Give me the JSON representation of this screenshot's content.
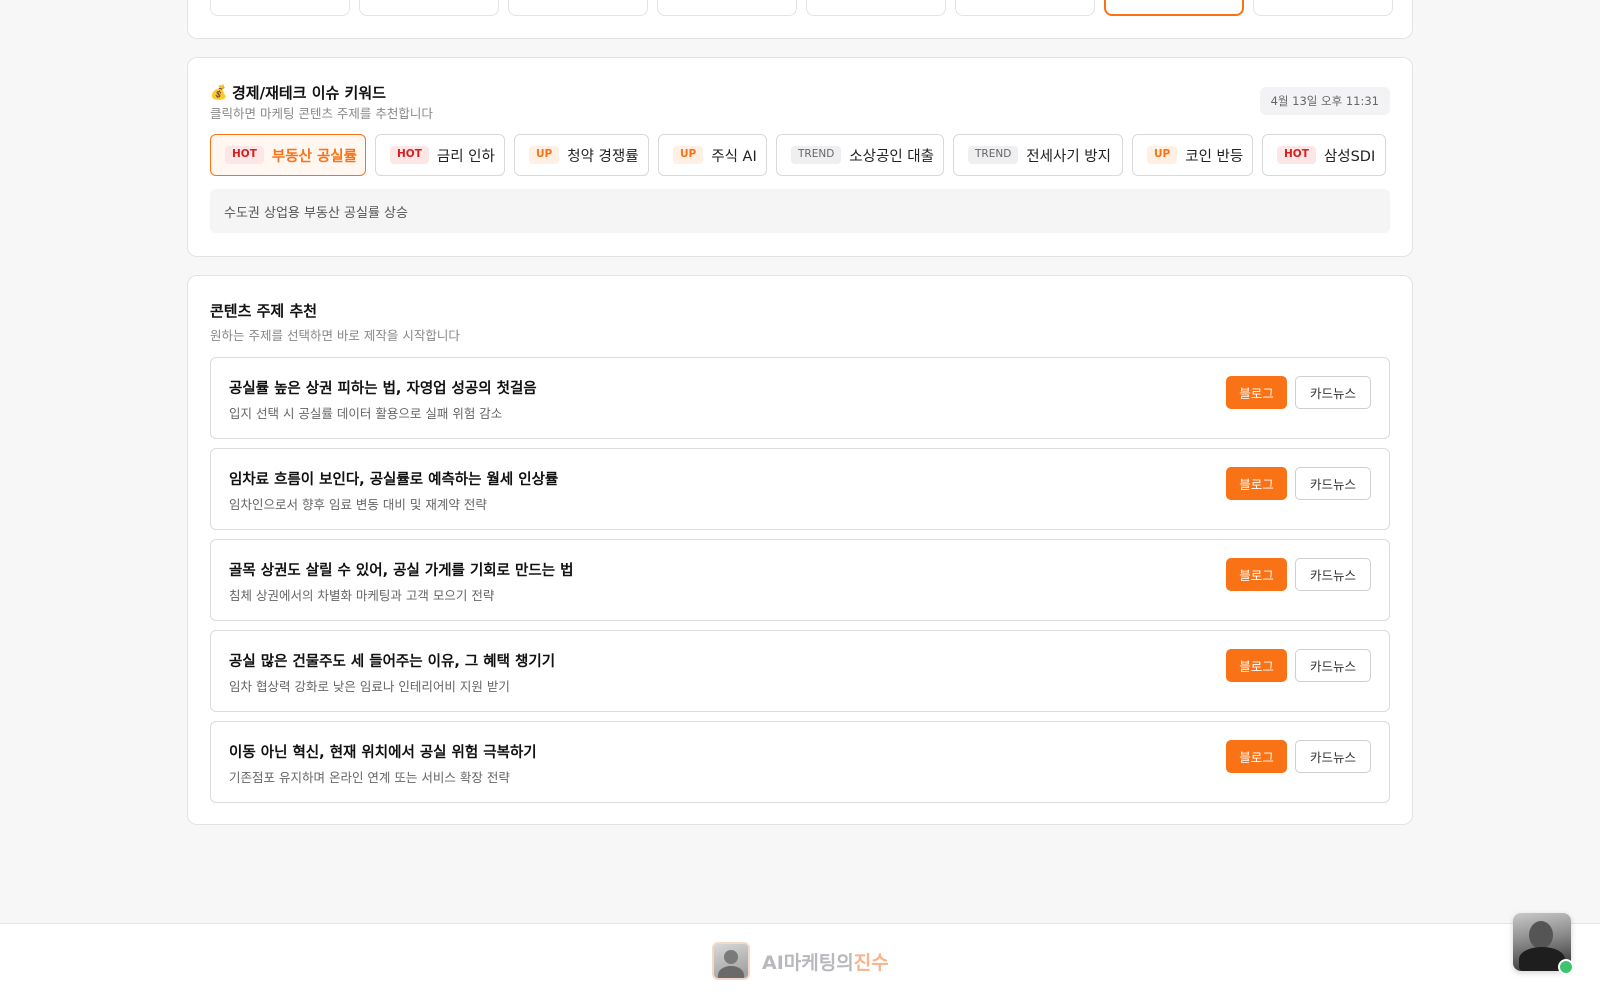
{
  "keywords_section": {
    "icon": "money-bag-icon",
    "title": "경제/재테크 이슈 키워드",
    "subtitle": "클릭하면 마케팅 콘텐츠 주제를 추천합니다",
    "timestamp": "4월 13일 오후 11:31",
    "chips": [
      {
        "badge": "HOT",
        "label": "부동산 공실률",
        "active": true
      },
      {
        "badge": "HOT",
        "label": "금리 인하",
        "active": false
      },
      {
        "badge": "UP",
        "label": "청약 경쟁률",
        "active": false
      },
      {
        "badge": "UP",
        "label": "주식 AI",
        "active": false
      },
      {
        "badge": "TREND",
        "label": "소상공인 대출",
        "active": false
      },
      {
        "badge": "TREND",
        "label": "전세사기 방지",
        "active": false
      },
      {
        "badge": "UP",
        "label": "코인 반등",
        "active": false
      },
      {
        "badge": "HOT",
        "label": "삼성SDI",
        "active": false
      }
    ],
    "selected_description": "수도권 상업용 부동산 공실률 상승"
  },
  "topics_section": {
    "title": "콘텐츠 주제 추천",
    "subtitle": "원하는 주제를 선택하면 바로 제작을 시작합니다",
    "blog_label": "블로그",
    "cardnews_label": "카드뉴스",
    "items": [
      {
        "title": "공실률 높은 상권 피하는 법, 자영업 성공의 첫걸음",
        "desc": "입지 선택 시 공실률 데이터 활용으로 실패 위험 감소"
      },
      {
        "title": "임차료 흐름이 보인다, 공실률로 예측하는 월세 인상률",
        "desc": "임차인으로서 향후 임료 변동 대비 및 재계약 전략"
      },
      {
        "title": "골목 상권도 살릴 수 있어, 공실 가게를 기회로 만드는 법",
        "desc": "침체 상권에서의 차별화 마케팅과 고객 모으기 전략"
      },
      {
        "title": "공실 많은 건물주도 세 들어주는 이유, 그 혜택 챙기기",
        "desc": "임차 협상력 강화로 낮은 임료나 인테리어비 지원 받기"
      },
      {
        "title": "이동 아닌 혁신, 현재 위치에서 공실 위험 극복하기",
        "desc": "기존점포 유지하며 온라인 연계 또는 서비스 확장 전략"
      }
    ]
  },
  "footer": {
    "brand_main": "AI마케팅의",
    "brand_accent": "진수"
  },
  "colors": {
    "accent": "#f97316",
    "hot": "#d42020",
    "online": "#3ec46d"
  }
}
